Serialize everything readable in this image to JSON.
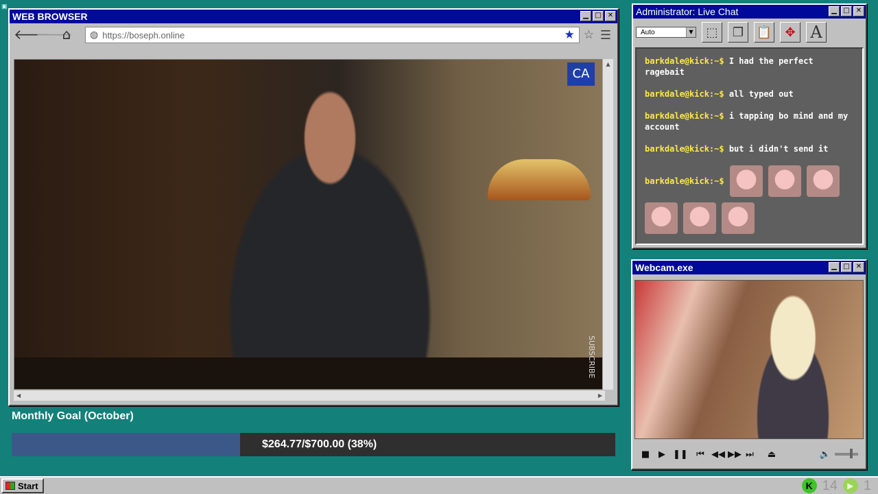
{
  "browser": {
    "title": "WEB BROWSER",
    "url": "https://boseph.online",
    "nav": {
      "back": "🡐",
      "forward": "🡒",
      "home": "⌂"
    },
    "icons": {
      "globe": "◍",
      "bookmark_filled": "★",
      "bookmark_empty": "☆",
      "menu": "☰"
    },
    "video_logo": "CA",
    "video_watermark": "SUBSCRIBE"
  },
  "window_controls": {
    "minimize": "▁",
    "maximize": "□",
    "close": "✕"
  },
  "goal": {
    "title": "Monthly Goal (October)",
    "text": "$264.77/$700.00 (38%)",
    "raised": 264.77,
    "target": 700.0,
    "percent": 38,
    "fill_color": "#3b5888",
    "track_color": "#2f2f2f"
  },
  "chat": {
    "title": "Administrator: Live Chat",
    "font_select": "Auto",
    "toolbar_text_tool": "A",
    "messages": [
      {
        "user": "barkdale@kick:~$",
        "text": "I had the perfect ragebait"
      },
      {
        "user": "barkdale@kick:~$",
        "text": "all typed out"
      },
      {
        "user": "barkdale@kick:~$",
        "text": "i tapping bo mind and my account"
      },
      {
        "user": "barkdale@kick:~$",
        "text": "but i didn't send it"
      },
      {
        "user": "barkdale@kick:~$",
        "text": "",
        "emote_count": 6
      }
    ]
  },
  "webcam": {
    "title": "Webcam.exe",
    "controls": [
      "stop",
      "play",
      "pause",
      "previous",
      "rewind",
      "fast-forward",
      "next",
      "eject"
    ]
  },
  "taskbar": {
    "start_label": "Start",
    "tray": {
      "kick_viewers": "14",
      "kick_letter": "K",
      "other_count": "1"
    }
  },
  "colors": {
    "desktop": "#13807a",
    "titlebar": "#000a9a",
    "chat_username": "#ffe84a"
  }
}
